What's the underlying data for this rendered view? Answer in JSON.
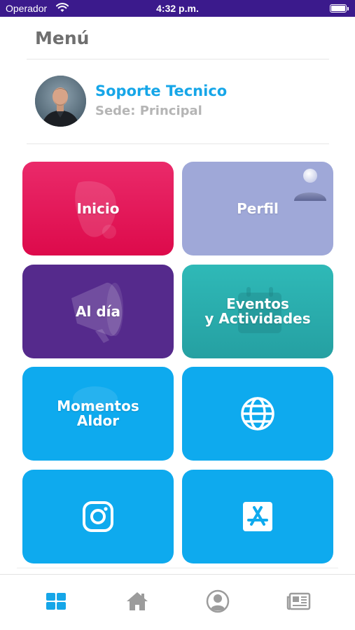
{
  "status_bar": {
    "carrier": "Operador",
    "time": "4:32 p.m.",
    "battery_level": 1.0
  },
  "header": {
    "title": "Menú"
  },
  "profile": {
    "name": "Soporte Tecnico",
    "site": "Sede: Principal",
    "avatar_icon": "user-photo"
  },
  "tiles": [
    {
      "label": "Inicio",
      "color": "#e0124f"
    },
    {
      "label": "Perfil",
      "color": "#9fa8d8",
      "icon": "user-3d-icon"
    },
    {
      "label": "Al día",
      "color": "#552a8c",
      "icon": "megaphone-icon"
    },
    {
      "label": "Eventos\ny Actividades",
      "color": "#2aaeae",
      "icon": "calendar-icon"
    },
    {
      "label": "Momentos\nAldor",
      "color": "#0eaaee"
    },
    {
      "label": "",
      "color": "#0eaaee",
      "icon": "globe-icon"
    },
    {
      "label": "",
      "color": "#0eaaee",
      "icon": "instagram-icon"
    },
    {
      "label": "",
      "color": "#0eaaee",
      "icon": "app-store-icon"
    }
  ],
  "tabbar": {
    "active_color": "#16a6e8",
    "inactive_color": "#9c9c9c",
    "items": [
      {
        "icon": "grid-icon",
        "active": true
      },
      {
        "icon": "home-icon",
        "active": false
      },
      {
        "icon": "user-icon",
        "active": false
      },
      {
        "icon": "news-icon",
        "active": false
      }
    ]
  }
}
